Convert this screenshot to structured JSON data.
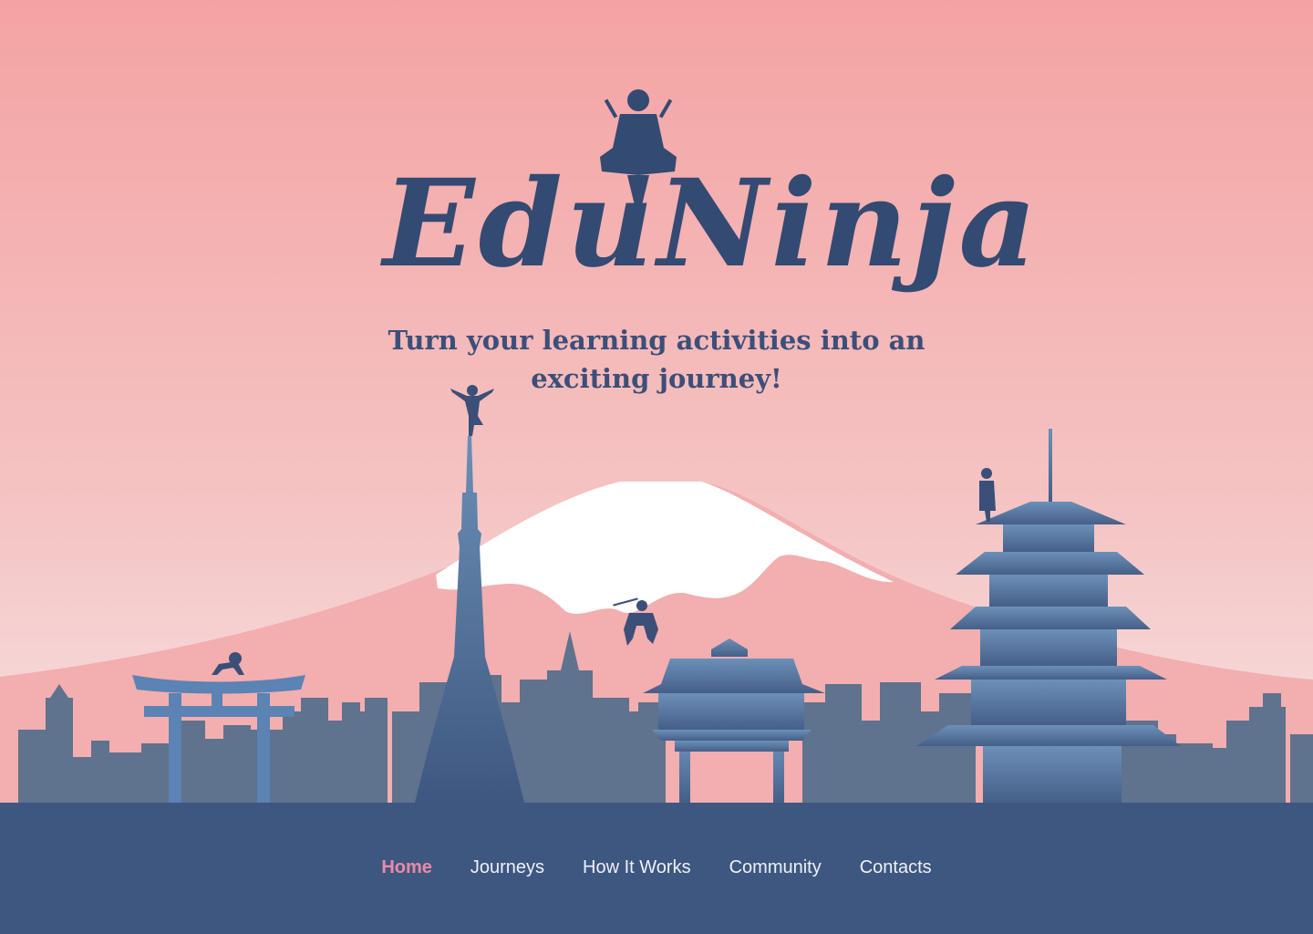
{
  "brand": {
    "name": "EduNinja",
    "tagline_line1": "Turn your learning activities into an",
    "tagline_line2": "exciting journey!"
  },
  "nav": {
    "items": [
      {
        "label": "Home",
        "active": true
      },
      {
        "label": "Journeys",
        "active": false
      },
      {
        "label": "How It Works",
        "active": false
      },
      {
        "label": "Community",
        "active": false
      },
      {
        "label": "Contacts",
        "active": false
      }
    ]
  },
  "colors": {
    "sky_top": "#f4a3a3",
    "sky_bottom": "#f6e0e0",
    "mountain": "#f3aeb0",
    "snow": "#ffffff",
    "city": "#5f728e",
    "landmarks": "#4f6a96",
    "footer": "#3e5780",
    "logo": "#334a72",
    "nav_active": "#e88aa8",
    "nav_text": "#eef1f7"
  },
  "icons": [
    "ninja-meditating-icon",
    "torii-gate-icon",
    "tokyo-tower-icon",
    "temple-gate-icon",
    "pagoda-icon"
  ]
}
